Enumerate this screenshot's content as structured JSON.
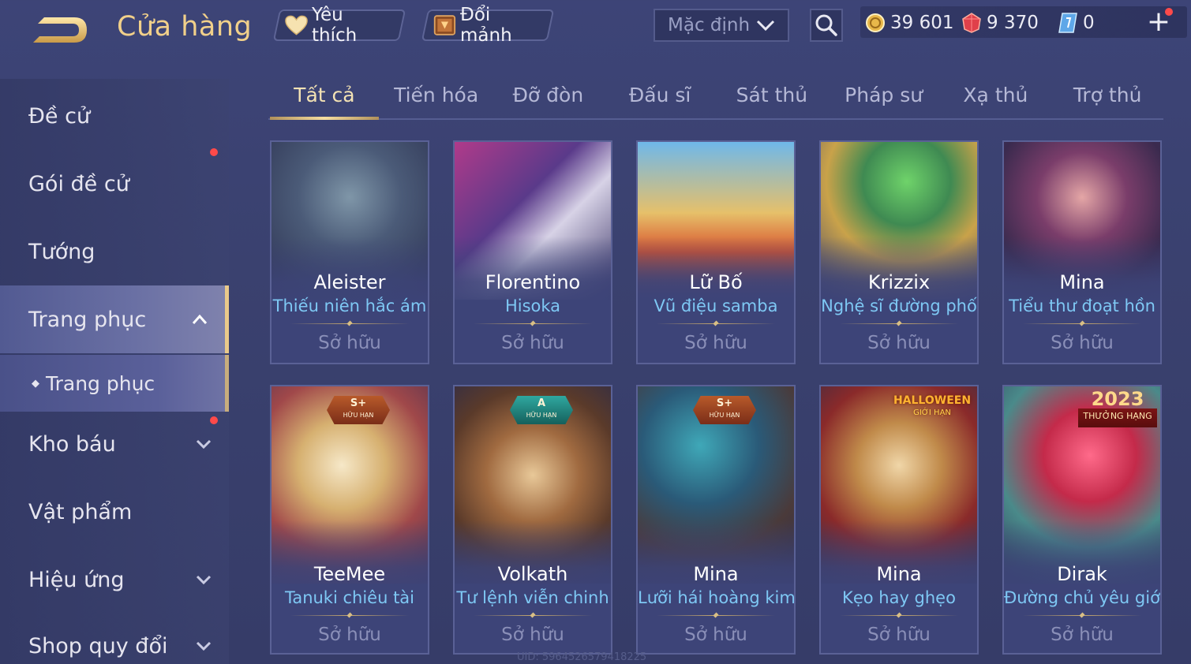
{
  "header": {
    "title": "Cửa hàng",
    "favorites_label": "Yêu thích",
    "exchange_label": "Đổi mảnh",
    "sort": {
      "selected": "Mặc định"
    },
    "currencies": {
      "gold": "39 601",
      "ruby": "9 370",
      "voucher": "0"
    },
    "add_label": "+"
  },
  "sidebar": {
    "items": [
      {
        "label": "Đề cử"
      },
      {
        "label": "Gói đề cử"
      },
      {
        "label": "Tướng"
      },
      {
        "label": "Trang phục"
      },
      {
        "label": "Trang phục"
      },
      {
        "label": "Kho báu"
      },
      {
        "label": "Vật phẩm"
      },
      {
        "label": "Hiệu ứng"
      },
      {
        "label": "Shop quy đổi"
      }
    ]
  },
  "tabs": [
    {
      "label": "Tất cả"
    },
    {
      "label": "Tiến hóa"
    },
    {
      "label": "Đỡ đòn"
    },
    {
      "label": "Đấu sĩ"
    },
    {
      "label": "Sát thủ"
    },
    {
      "label": "Pháp sư"
    },
    {
      "label": "Xạ thủ"
    },
    {
      "label": "Trợ thủ"
    }
  ],
  "skins": [
    {
      "hero": "Aleister",
      "skin": "Thiếu niên hắc ám",
      "status": "Sở hữu"
    },
    {
      "hero": "Florentino",
      "skin": "Hisoka",
      "status": "Sở hữu"
    },
    {
      "hero": "Lữ Bố",
      "skin": "Vũ điệu samba",
      "status": "Sở hữu"
    },
    {
      "hero": "Krizzix",
      "skin": "Nghệ sĩ đường phố",
      "status": "Sở hữu"
    },
    {
      "hero": "Mina",
      "skin": "Tiểu thư đoạt hồn",
      "status": "Sở hữu"
    },
    {
      "hero": "TeeMee",
      "skin": "Tanuki chiêu tài",
      "status": "Sở hữu",
      "badge": "S+",
      "badge_sub": "HỮU HẠN"
    },
    {
      "hero": "Volkath",
      "skin": "Tư lệnh viễn chinh",
      "status": "Sở hữu",
      "badge": "A",
      "badge_sub": "HỮU HẠN"
    },
    {
      "hero": "Mina",
      "skin": "Lưỡi hái hoàng kim",
      "status": "Sở hữu",
      "badge": "S+",
      "badge_sub": "HỮU HẠN"
    },
    {
      "hero": "Mina",
      "skin": "Kẹo hay ghẹo",
      "status": "Sở hữu",
      "badge": "HALLOWEEN",
      "badge_sub": "GIỚI HẠN"
    },
    {
      "hero": "Dirak",
      "skin": "Đường chủ yêu giới",
      "status": "Sở hữu",
      "badge": "2023",
      "badge_sub": "THƯỞNG HẠNG"
    }
  ],
  "footer": {
    "uid": "UID: 5964526579418225"
  },
  "colors": {
    "accent_gold": "#f1d08a",
    "skin_name": "#7ec8f4",
    "notification": "#ff4a4a"
  }
}
